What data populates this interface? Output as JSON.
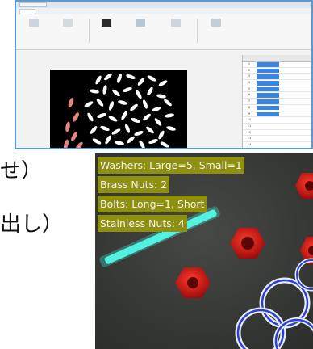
{
  "app_window": {
    "title": "",
    "ribbon_tabs": [],
    "ribbon_groups": [],
    "table": {
      "headers": [
        "",
        "",
        ""
      ],
      "rows": [
        {
          "idx": "1",
          "v1": "",
          "v2": "",
          "selected": true
        },
        {
          "idx": "2",
          "v1": "",
          "v2": "",
          "selected": true
        },
        {
          "idx": "3",
          "v1": "",
          "v2": "",
          "selected": true
        },
        {
          "idx": "4",
          "v1": "",
          "v2": "",
          "selected": true
        },
        {
          "idx": "5",
          "v1": "",
          "v2": "",
          "selected": true
        },
        {
          "idx": "6",
          "v1": "",
          "v2": "",
          "selected": true
        },
        {
          "idx": "7",
          "v1": "",
          "v2": "",
          "selected": true
        },
        {
          "idx": "8",
          "v1": "",
          "v2": "",
          "selected": true
        },
        {
          "idx": "9",
          "v1": "",
          "v2": "",
          "selected": true
        },
        {
          "idx": "10",
          "v1": "",
          "v2": "",
          "selected": false
        },
        {
          "idx": "11",
          "v1": "",
          "v2": "",
          "selected": false
        },
        {
          "idx": "12",
          "v1": "",
          "v2": "",
          "selected": false
        },
        {
          "idx": "13",
          "v1": "",
          "v2": "",
          "selected": false
        },
        {
          "idx": "14",
          "v1": "",
          "v2": "",
          "selected": false
        },
        {
          "idx": "15",
          "v1": "",
          "v2": "",
          "selected": false
        }
      ]
    },
    "colors": {
      "frame_border": "#5b9bd5",
      "selection": "#3b85e0",
      "highlight_object": "#e8857a",
      "object": "#ffffff"
    }
  },
  "left_text": {
    "line1": "せ）",
    "line2": "出し）"
  },
  "detection": {
    "labels": [
      "Washers: Large=5, Small=1",
      "Brass Nuts: 2",
      "Bolts: Long=1, Short",
      "Stainless Nuts: 4"
    ],
    "colors": {
      "label_bg": "#8f8f10",
      "label_text": "#f2f2f2",
      "nut": "#c81414",
      "washer_outline": "#2a3fd8",
      "bolt": "#3fe0d0",
      "background": "#3b3d3b"
    }
  }
}
